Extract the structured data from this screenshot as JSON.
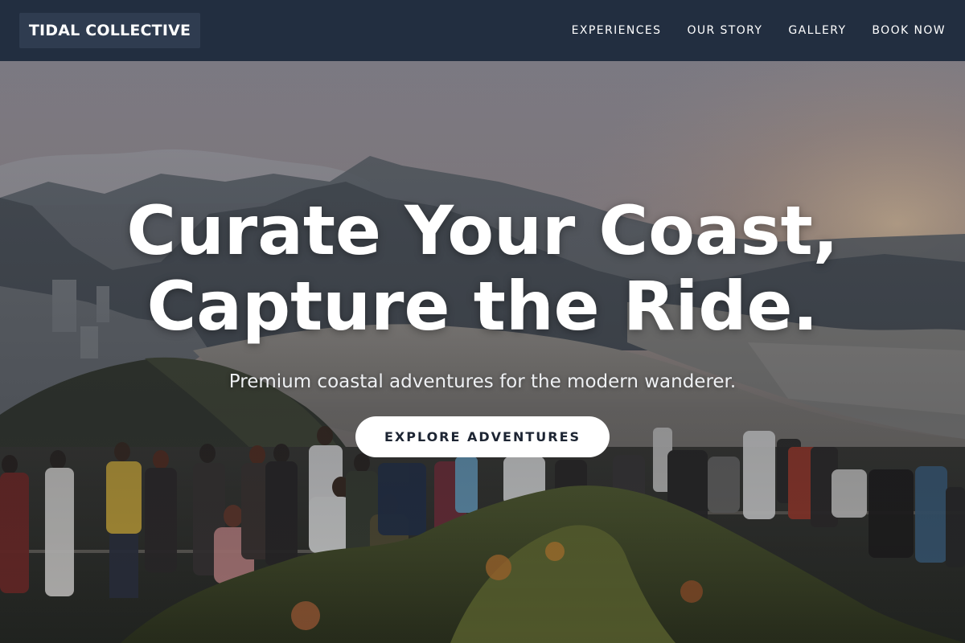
{
  "header": {
    "logo": "TIDAL COLLECTIVE",
    "nav": [
      {
        "label": "EXPERIENCES"
      },
      {
        "label": "OUR STORY"
      },
      {
        "label": "GALLERY"
      },
      {
        "label": "BOOK NOW"
      }
    ]
  },
  "hero": {
    "title_line1": "Curate Your Coast,",
    "title_line2": "Capture the Ride.",
    "subtitle": "Premium coastal adventures for the modern wanderer.",
    "cta_label": "EXPLORE ADVENTURES"
  },
  "colors": {
    "header_bg": "#222e40",
    "logo_bg": "#2f3c50",
    "cta_bg": "#ffffff",
    "cta_text": "#1d2533"
  }
}
